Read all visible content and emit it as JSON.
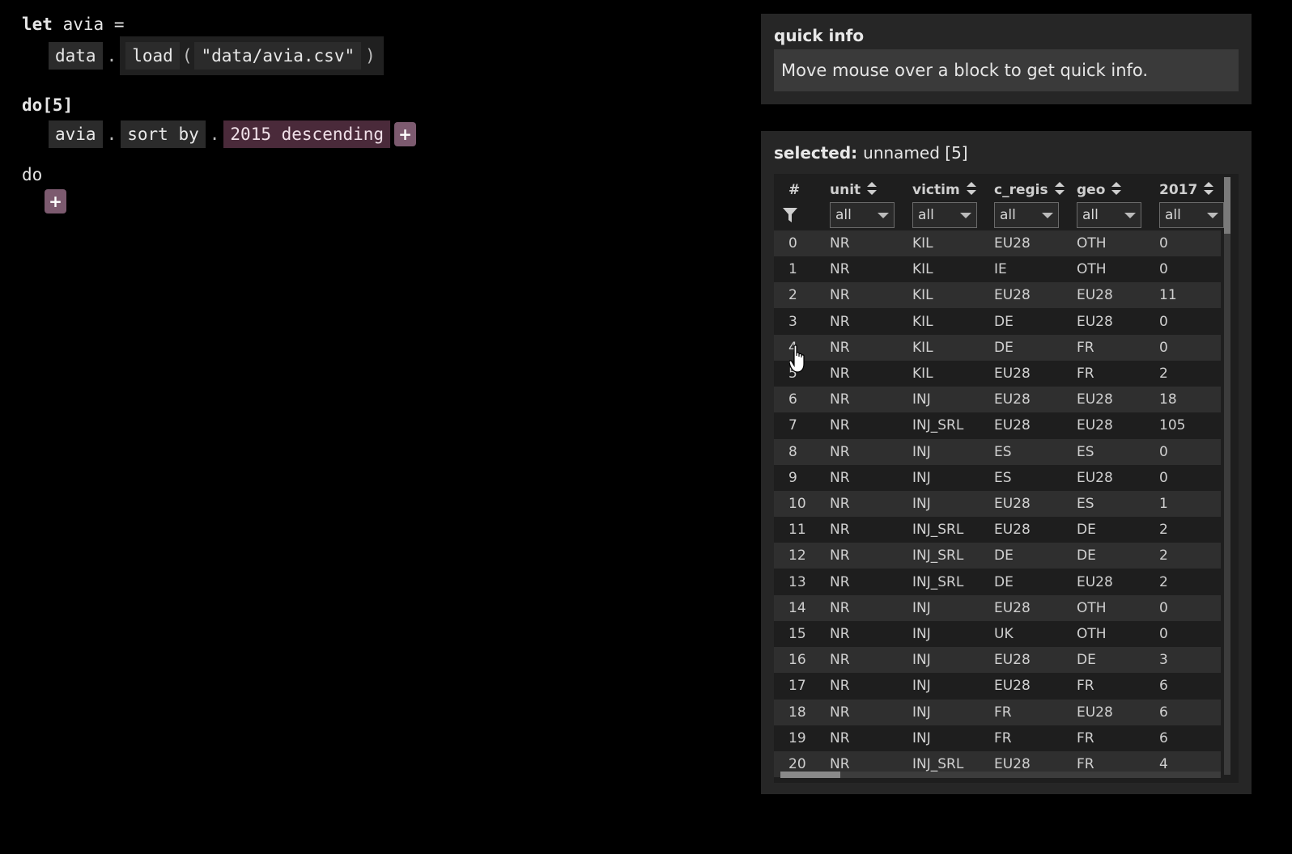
{
  "editor": {
    "let_kw": "let",
    "let_name": "avia",
    "let_eq": "=",
    "load_tokens": [
      "data",
      "load",
      "\"data/avia.csv\""
    ],
    "dot": ".",
    "lparen": "(",
    "rparen": ")",
    "do5_label": "do[5]",
    "sort_tokens": [
      "avia",
      "sort by",
      "2015 descending"
    ],
    "plus": "+",
    "do_label": "do"
  },
  "quick_info": {
    "title": "quick info",
    "message": "Move mouse over a block to get quick info."
  },
  "selected": {
    "label": "selected:",
    "value": "unnamed [5]"
  },
  "table": {
    "columns": [
      "#",
      "unit",
      "victim",
      "c_regis",
      "geo",
      "2017"
    ],
    "filters": [
      "all",
      "all",
      "all",
      "all",
      "all"
    ],
    "rows": [
      [
        "0",
        "NR",
        "KIL",
        "EU28",
        "OTH",
        "0"
      ],
      [
        "1",
        "NR",
        "KIL",
        "IE",
        "OTH",
        "0"
      ],
      [
        "2",
        "NR",
        "KIL",
        "EU28",
        "EU28",
        "11"
      ],
      [
        "3",
        "NR",
        "KIL",
        "DE",
        "EU28",
        "0"
      ],
      [
        "4",
        "NR",
        "KIL",
        "DE",
        "FR",
        "0"
      ],
      [
        "5",
        "NR",
        "KIL",
        "EU28",
        "FR",
        "2"
      ],
      [
        "6",
        "NR",
        "INJ",
        "EU28",
        "EU28",
        "18"
      ],
      [
        "7",
        "NR",
        "INJ_SRL",
        "EU28",
        "EU28",
        "105"
      ],
      [
        "8",
        "NR",
        "INJ",
        "ES",
        "ES",
        "0"
      ],
      [
        "9",
        "NR",
        "INJ",
        "ES",
        "EU28",
        "0"
      ],
      [
        "10",
        "NR",
        "INJ",
        "EU28",
        "ES",
        "1"
      ],
      [
        "11",
        "NR",
        "INJ_SRL",
        "EU28",
        "DE",
        "2"
      ],
      [
        "12",
        "NR",
        "INJ_SRL",
        "DE",
        "DE",
        "2"
      ],
      [
        "13",
        "NR",
        "INJ_SRL",
        "DE",
        "EU28",
        "2"
      ],
      [
        "14",
        "NR",
        "INJ",
        "EU28",
        "OTH",
        "0"
      ],
      [
        "15",
        "NR",
        "INJ",
        "UK",
        "OTH",
        "0"
      ],
      [
        "16",
        "NR",
        "INJ",
        "EU28",
        "DE",
        "3"
      ],
      [
        "17",
        "NR",
        "INJ",
        "EU28",
        "FR",
        "6"
      ],
      [
        "18",
        "NR",
        "INJ",
        "FR",
        "EU28",
        "6"
      ],
      [
        "19",
        "NR",
        "INJ",
        "FR",
        "FR",
        "6"
      ],
      [
        "20",
        "NR",
        "INJ_SRL",
        "EU28",
        "FR",
        "4"
      ]
    ]
  }
}
